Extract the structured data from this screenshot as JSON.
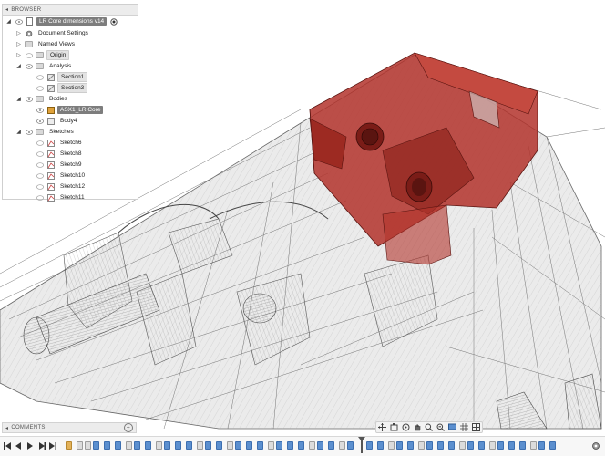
{
  "browser": {
    "title": "BROWSER",
    "document": "LR Core dimensions v14",
    "items": [
      {
        "label": "Document Settings",
        "icon": "gear-icon"
      },
      {
        "label": "Named Views",
        "icon": "folder-icon"
      },
      {
        "label": "Origin",
        "icon": "folder-icon"
      },
      {
        "label": "Analysis",
        "icon": "folder-icon"
      },
      {
        "label": "Section1",
        "icon": "section-icon"
      },
      {
        "label": "Section3",
        "icon": "section-icon"
      },
      {
        "label": "Bodies",
        "icon": "folder-icon"
      },
      {
        "label": "ASX1_LR Core",
        "icon": "body-icon"
      },
      {
        "label": "Body4",
        "icon": "body-icon"
      },
      {
        "label": "Sketches",
        "icon": "folder-icon"
      },
      {
        "label": "Sketch6",
        "icon": "sketch-icon"
      },
      {
        "label": "Sketch8",
        "icon": "sketch-icon"
      },
      {
        "label": "Sketch9",
        "icon": "sketch-icon"
      },
      {
        "label": "Sketch10",
        "icon": "sketch-icon"
      },
      {
        "label": "Sketch12",
        "icon": "sketch-icon"
      },
      {
        "label": "Sketch11",
        "icon": "sketch-icon"
      }
    ]
  },
  "comments": {
    "title": "COMMENTS"
  },
  "colors": {
    "accent_red": "#b3332b",
    "timeline_blue": "#5b8fcf",
    "selected": "#7d7d7d"
  },
  "navbar": {
    "icons": [
      "move-icon",
      "look-at-icon",
      "orbit-icon",
      "pan-icon",
      "zoom-icon",
      "fit-icon",
      "display-settings-icon",
      "grid-icon",
      "viewports-icon"
    ]
  },
  "timeline": {
    "controls": [
      "go-to-start-icon",
      "previous-step-icon",
      "play-icon",
      "next-step-icon",
      "go-to-end-icon"
    ]
  }
}
